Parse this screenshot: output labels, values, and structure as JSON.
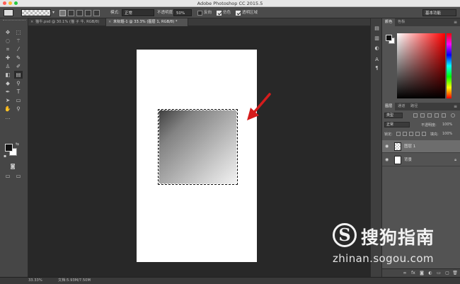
{
  "app": {
    "title": "Adobe Photoshop CC 2015.5",
    "traffic_lights": [
      "#ff5f57",
      "#febc2e",
      "#28c840"
    ]
  },
  "options_bar": {
    "mode_label": "模式:",
    "mode_value": "正常",
    "opacity_label": "不透明度:",
    "opacity_value": "50%",
    "reverse_label": "反向",
    "dither_label": "仿色",
    "transparency_label": "透明区域",
    "workspace": "基本功能"
  },
  "tabs": [
    {
      "label": "猫牛.psd @ 30.1% (猫 子 牛, RGB/8)"
    },
    {
      "label": "未标题-1 @ 33.3% (图层 1, RGB/8) *"
    }
  ],
  "status": {
    "zoom": "33.33%",
    "doc": "文档:5.93M/7.50M"
  },
  "color_panel": {
    "tabs": [
      "颜色",
      "色板"
    ],
    "fg": "#111111",
    "bg": "#ffffff"
  },
  "layers_panel": {
    "tabs": [
      "图层",
      "通道",
      "路径"
    ],
    "filter_kind": "类型",
    "blend_mode": "正常",
    "opacity_label": "不透明度:",
    "opacity_value": "100%",
    "lock_label": "锁定:",
    "fill_label": "填充:",
    "fill_value": "100%",
    "layers": [
      {
        "name": "图层 1",
        "selected": true
      },
      {
        "name": "背景",
        "selected": false,
        "locked": true
      }
    ]
  },
  "icons": {
    "tools": [
      "move-icon",
      "marquee-icon",
      "lasso-icon",
      "magic-wand-icon",
      "crop-icon",
      "eyedropper-icon",
      "healing-icon",
      "brush-icon",
      "stamp-icon",
      "history-brush-icon",
      "eraser-icon",
      "gradient-icon",
      "blur-icon",
      "dodge-icon",
      "pen-icon",
      "type-icon",
      "path-select-icon",
      "rectangle-icon",
      "hand-icon",
      "zoom-icon"
    ],
    "arrow_annotation_color": "#d41c1c"
  },
  "watermark": {
    "brand": "搜狗指南",
    "url": "zhinan.sogou.com"
  }
}
